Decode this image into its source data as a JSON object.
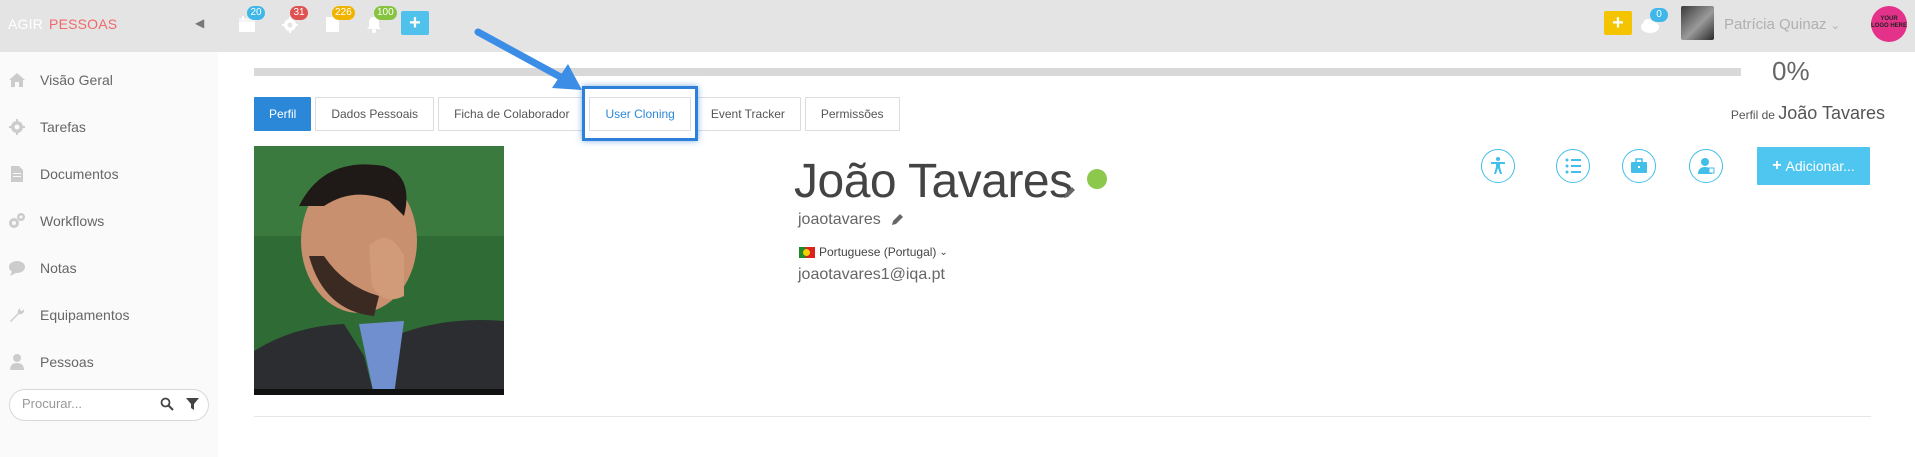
{
  "brand": {
    "part1": "AGIR",
    "part2": "PESSOAS"
  },
  "topbar": {
    "badges": {
      "calendar": "20",
      "settings": "31",
      "documents": "226",
      "notifications": "100",
      "messages": "0"
    },
    "user_name": "Patrícia Quinaz",
    "logo_text": "YOUR LOGO HERE",
    "colors": {
      "bar": "#e4e4e4",
      "accent": "#4fc1ea",
      "yellow": "#f5c400",
      "badge_blue": "#3fb7e8",
      "badge_red": "#e05252",
      "badge_yellow": "#f0b400",
      "badge_green": "#86c440"
    }
  },
  "sidebar": {
    "items": [
      {
        "label": "Visão Geral",
        "icon": "home-icon"
      },
      {
        "label": "Tarefas",
        "icon": "gear-icon"
      },
      {
        "label": "Documentos",
        "icon": "document-icon"
      },
      {
        "label": "Workflows",
        "icon": "gears-icon"
      },
      {
        "label": "Notas",
        "icon": "chat-icon"
      },
      {
        "label": "Equipamentos",
        "icon": "wrench-icon"
      },
      {
        "label": "Pessoas",
        "icon": "person-icon"
      }
    ],
    "search_placeholder": "Procurar..."
  },
  "main": {
    "progress_fraction": 0,
    "progress_label": "0%",
    "tabs": [
      {
        "label": "Perfil",
        "active": true
      },
      {
        "label": "Dados Pessoais"
      },
      {
        "label": "Ficha de Colaborador"
      },
      {
        "label": "User Cloning",
        "highlighted": true
      },
      {
        "label": "Event Tracker"
      },
      {
        "label": "Permissões"
      }
    ],
    "profile_of_prefix": "Perfil de",
    "profile_of_name": "João Tavares",
    "full_name": "João Tavares",
    "username": "joaotavares",
    "language": "Portuguese (Portugal)",
    "email": "joaotavares1@iqa.pt",
    "add_button": "Adicionar...",
    "status_color": "#8cc84b"
  }
}
